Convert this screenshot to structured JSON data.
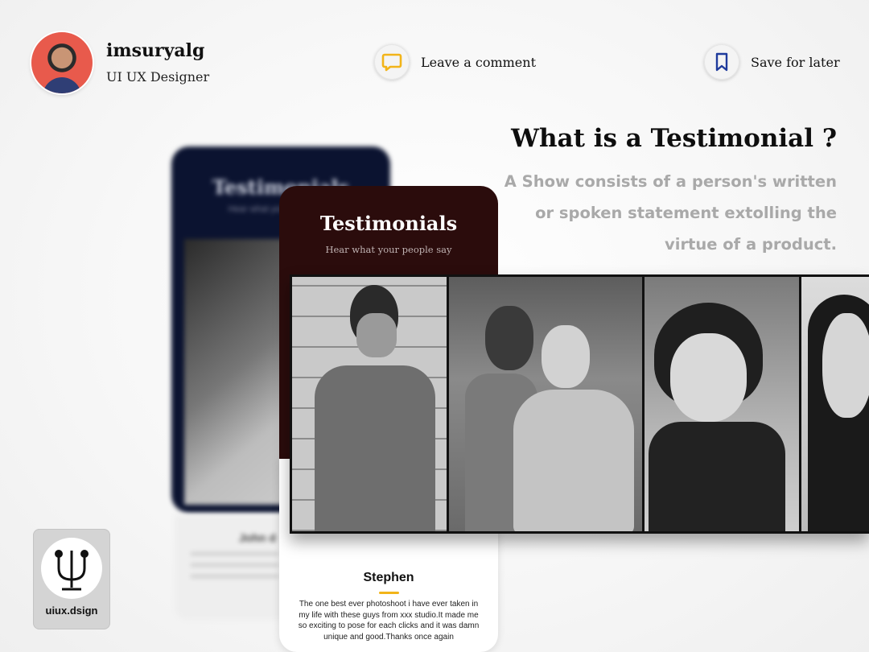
{
  "profile": {
    "username": "imsuryalg",
    "role": "UI UX Designer"
  },
  "actions": {
    "comment_label": "Leave a comment",
    "save_label": "Save for later"
  },
  "colors": {
    "comment_icon": "#f2b419",
    "bookmark_icon": "#1f3b9c",
    "card_front": "#2b0c0c",
    "card_back": "#0b1330",
    "underline": "#f2b419"
  },
  "heading": {
    "title": "What is a Testimonial ?",
    "lines": [
      "A Show consists of a person's written",
      "or spoken statement extolling the",
      "virtue of a product."
    ]
  },
  "back_card": {
    "title": "Testimonials",
    "subtitle": "Hear what your people say",
    "name": "John d"
  },
  "front_card": {
    "title": "Testimonials",
    "subtitle": "Hear what your people say",
    "name": "Stephen",
    "quote": "The one best ever photoshoot i have ever taken in my life with these guys from xxx studio.It made me so exciting to pose for each clicks and it was damn unique and good.Thanks once again"
  },
  "logo": {
    "text": "uiux.dsign",
    "icon": "psi-logo-icon"
  }
}
